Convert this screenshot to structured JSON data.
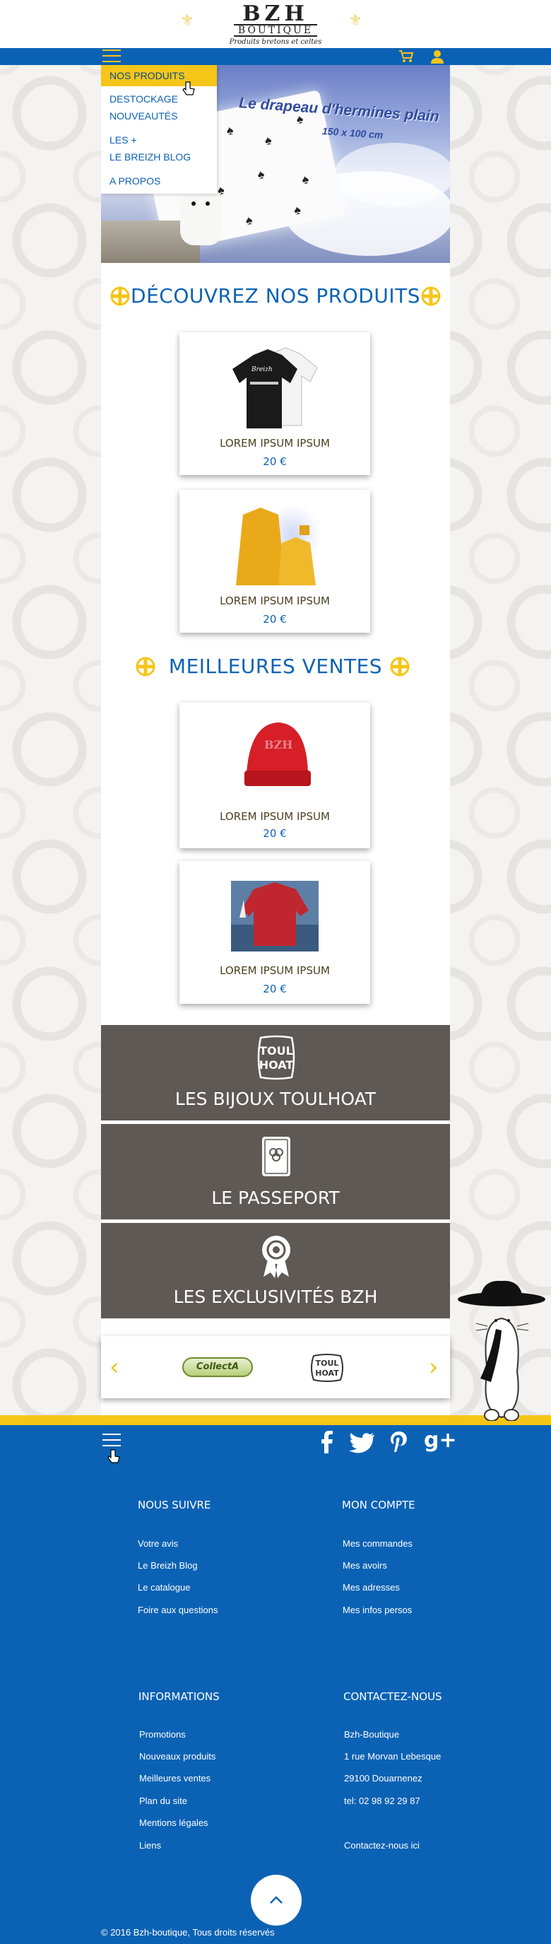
{
  "header": {
    "logo_main": "BZH",
    "logo_sub": "BOUTIQUE",
    "logo_tagline": "Produits bretons et celtes"
  },
  "menu": {
    "items": [
      {
        "label": "NOS PRODUITS",
        "active": true
      },
      {
        "label": "DESTOCKAGE"
      },
      {
        "label": "NOUVEAUTÉS"
      },
      {
        "label": "LES +"
      },
      {
        "label": "LE BREIZH BLOG"
      },
      {
        "label": "A PROPOS"
      }
    ]
  },
  "hero": {
    "title": "Le drapeau d'hermines plain",
    "size": "150 x 100 cm"
  },
  "sections": {
    "discover": "DÉCOUVREZ NOS PRODUITS",
    "best": "MEILLEURES VENTES"
  },
  "products": [
    {
      "name": "LOREM IPSUM IPSUM",
      "price": "20 €",
      "image": "black-polo-shirt"
    },
    {
      "name": "LOREM IPSUM IPSUM",
      "price": "20 €",
      "image": "yellow-raincoat"
    },
    {
      "name": "LOREM IPSUM IPSUM",
      "price": "20 €",
      "image": "red-beanie"
    },
    {
      "name": "LOREM IPSUM IPSUM",
      "price": "20 €",
      "image": "red-sweater"
    }
  ],
  "blocks": [
    {
      "label": "LES BIJOUX TOULHOAT",
      "icon": "toulhoat-logo"
    },
    {
      "label": "LE PASSEPORT",
      "icon": "passport-icon"
    },
    {
      "label": "LES EXCLUSIVITÉS BZH",
      "icon": "award-ribbon-icon"
    }
  ],
  "carousel": {
    "prev": "‹",
    "next": "›",
    "logos": [
      "CollectA",
      "Toulhoat"
    ]
  },
  "social": [
    "facebook",
    "twitter",
    "pinterest",
    "google-plus"
  ],
  "footer": {
    "follow": {
      "title": "NOUS SUIVRE",
      "links": [
        "Votre avis",
        "Le Breizh Blog",
        "Le catalogue",
        "Foire aux questions"
      ]
    },
    "account": {
      "title": "MON COMPTE",
      "links": [
        "Mes commandes",
        "Mes avoirs",
        "Mes adresses",
        "Mes infos persos"
      ]
    },
    "info": {
      "title": "INFORMATIONS",
      "links": [
        "Promotions",
        "Nouveaux  produits",
        "Meilleures ventes",
        "Plan du site",
        "Mentions légales",
        "Liens"
      ]
    },
    "contact": {
      "title": "CONTACTEZ-NOUS",
      "lines": [
        "Bzh-Boutique",
        "1 rue Morvan Lebesque",
        "29100 Douarnenez",
        "tel: 02 98 92 29 87"
      ],
      "link": "Contactez-nous ici"
    },
    "copyright": "© 2016  Bzh-boutique, Tous droits réservés"
  },
  "colors": {
    "brand_blue": "#0b62b4",
    "accent_yellow": "#f5c518",
    "block_grey": "#5e5954"
  }
}
